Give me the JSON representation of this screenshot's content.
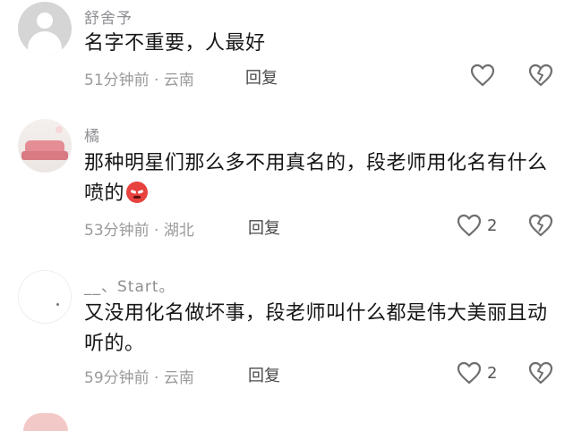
{
  "comments": [
    {
      "username": "舒舍予",
      "text": "名字不重要，人最好",
      "time_location": "51分钟前 · 云南",
      "reply_label": "回复",
      "like_count": ""
    },
    {
      "username": "橘",
      "text": "那种明星们那么多不用真名的，段老师用化名有什么喷的",
      "time_location": "53分钟前 · 湖北",
      "reply_label": "回复",
      "like_count": "2"
    },
    {
      "username": "__、Start。",
      "text": "又没用化名做坏事，段老师叫什么都是伟大美丽且动听的。",
      "time_location": "59分钟前 · 云南",
      "reply_label": "回复",
      "like_count": "2"
    }
  ],
  "icons": {
    "like": "heart-outline-icon",
    "dislike": "broken-heart-icon",
    "emoji": "angry-face-emoji"
  },
  "colors": {
    "text": "#161616",
    "meta": "#9a9a9a",
    "username": "#8e8e93",
    "icon": "#6f6f6f"
  }
}
